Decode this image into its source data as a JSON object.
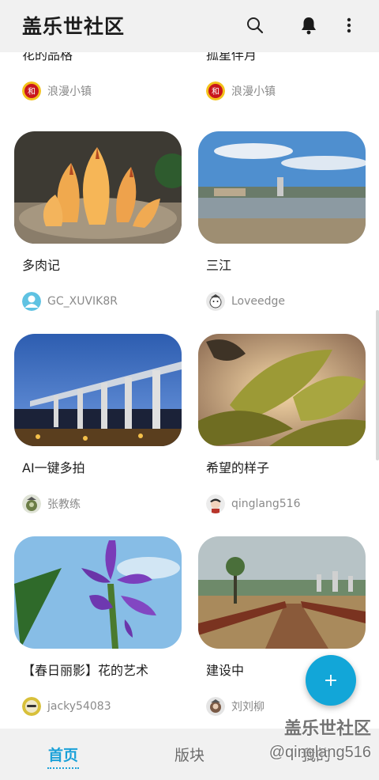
{
  "header": {
    "title": "盖乐世社区"
  },
  "partial_row": [
    {
      "title": "花的品格",
      "author": "浪漫小镇"
    },
    {
      "title": "孤星伴月",
      "author": "浪漫小镇"
    }
  ],
  "posts": [
    {
      "title": "多肉记",
      "author": "GC_XUVIK8R"
    },
    {
      "title": "三江",
      "author": "Loveedge"
    },
    {
      "title": "AI一键多拍",
      "author": "张教练"
    },
    {
      "title": "希望的样子",
      "author": "qinglang516"
    },
    {
      "title": "【春日丽影】花的艺术",
      "author": "jacky54083"
    },
    {
      "title": "建设中",
      "author": "刘刘柳"
    }
  ],
  "fab": {
    "label": "+"
  },
  "tabs": [
    {
      "label": "首页"
    },
    {
      "label": "版块"
    },
    {
      "label": "我的"
    }
  ],
  "watermark": {
    "line1": "盖乐世社区",
    "line2": "@qinglang516"
  },
  "colors": {
    "accent": "#1aa1d8",
    "header_bg": "#f1f1f1"
  }
}
